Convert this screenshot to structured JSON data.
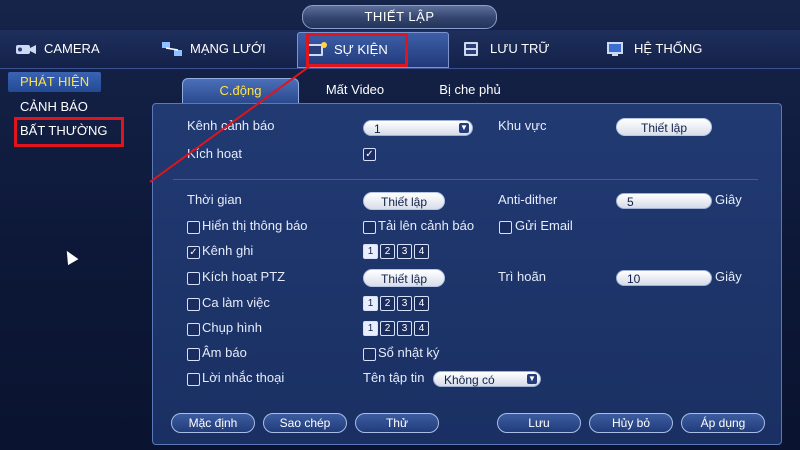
{
  "window": {
    "title": "THIẾT LẬP"
  },
  "top_tabs": [
    {
      "label": "CAMERA",
      "icon": "camera-icon"
    },
    {
      "label": "MẠNG LƯỚI",
      "icon": "network-icon"
    },
    {
      "label": "SỰ KIỆN",
      "icon": "event-icon",
      "active": true
    },
    {
      "label": "LƯU TRỮ",
      "icon": "storage-icon"
    },
    {
      "label": "HỆ THỐNG",
      "icon": "system-icon"
    }
  ],
  "left_menu": [
    {
      "label": "PHÁT HIỆN",
      "active": true
    },
    {
      "label": "CẢNH BÁO"
    },
    {
      "label": "BẤT THƯỜNG"
    }
  ],
  "sub_tabs": [
    {
      "label": "C.động",
      "active": true
    },
    {
      "label": "Mất Video"
    },
    {
      "label": "Bị che phủ"
    }
  ],
  "form": {
    "alarm_channel_label": "Kênh cảnh báo",
    "alarm_channel_value": "1",
    "region_label": "Khu vực",
    "region_button": "Thiết lập",
    "enable_label": "Kích hoạt",
    "enable_checked": true,
    "time_label": "Thời gian",
    "time_button": "Thiết lập",
    "anti_dither_label": "Anti-dither",
    "anti_dither_value": "5",
    "anti_dither_unit": "Giây",
    "show_message_label": "Hiển thị thông báo",
    "upload_alarm_label": "Tải lên cảnh báo",
    "send_email_label": "Gửi Email",
    "record_channel_label": "Kênh ghi",
    "record_channel_checked": true,
    "record_channels": [
      "1",
      "2",
      "3",
      "4"
    ],
    "ptz_label": "Kích hoạt PTZ",
    "ptz_button": "Thiết lập",
    "delay_label": "Trì hoãn",
    "delay_value": "10",
    "delay_unit": "Giây",
    "tour_label": "Ca làm việc",
    "tour_channels": [
      "1",
      "2",
      "3",
      "4"
    ],
    "snapshot_label": "Chụp hình",
    "snapshot_channels": [
      "1",
      "2",
      "3",
      "4"
    ],
    "buzzer_label": "Âm báo",
    "log_label": "Sổ nhật ký",
    "voice_label": "Lời nhắc thoại",
    "file_name_label": "Tên tập tin",
    "file_name_value": "Không có"
  },
  "buttons": {
    "default": "Mặc định",
    "copy": "Sao chép",
    "test": "Thử",
    "save": "Lưu",
    "cancel": "Hủy bỏ",
    "apply": "Áp dụng"
  },
  "colors": {
    "highlight_box": "#e0141c",
    "active_text": "#ffe24a",
    "panel_bg": "#213a72"
  }
}
